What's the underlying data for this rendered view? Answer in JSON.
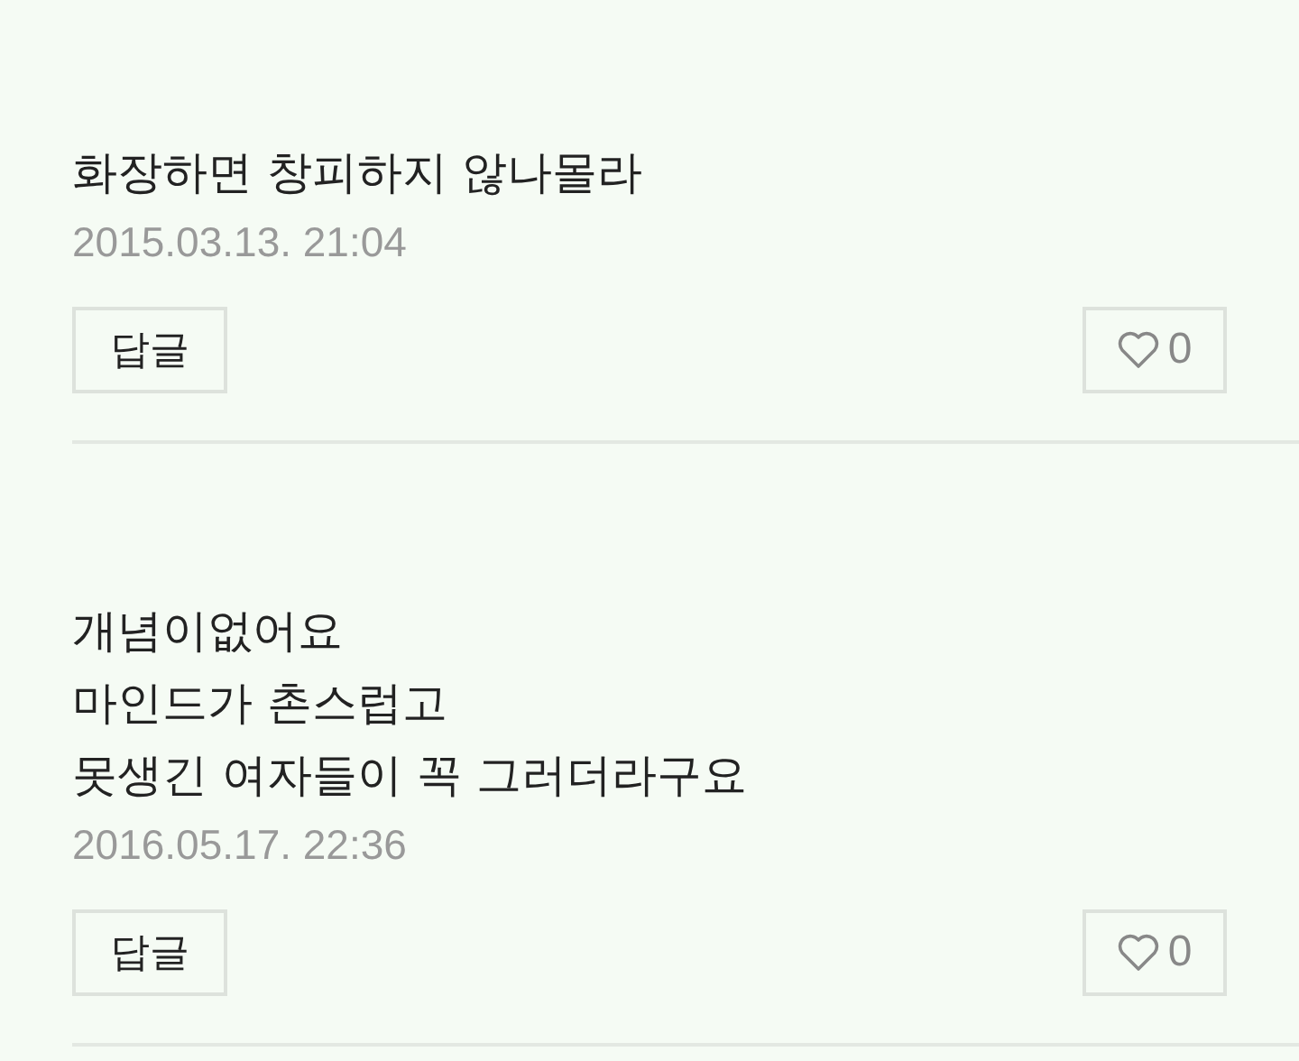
{
  "comments": [
    {
      "lines": [
        "화장하면 창피하지 않나몰라"
      ],
      "date": "2015.03.13. 21:04",
      "reply": "답글",
      "likes": "0"
    },
    {
      "lines": [
        "개념이없어요",
        "마인드가 촌스럽고",
        "못생긴 여자들이 꼭 그러더라구요"
      ],
      "date": "2016.05.17. 22:36",
      "reply": "답글",
      "likes": "0"
    }
  ]
}
